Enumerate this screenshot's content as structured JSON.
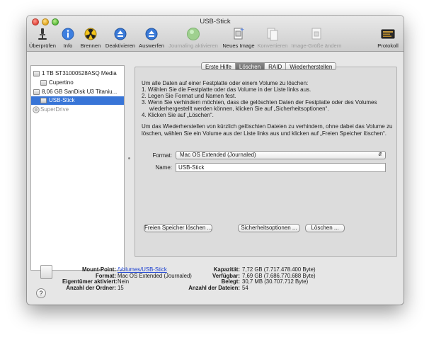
{
  "window": {
    "title": "USB-Stick"
  },
  "toolbar": {
    "items": [
      {
        "label": "Überprüfen",
        "icon": "microscope-icon",
        "enabled": true
      },
      {
        "label": "Info",
        "icon": "info-icon",
        "enabled": true
      },
      {
        "label": "Brennen",
        "icon": "burn-icon",
        "enabled": true
      },
      {
        "label": "Deaktivieren",
        "icon": "unmount-icon",
        "enabled": true
      },
      {
        "label": "Auswerfen",
        "icon": "eject-icon",
        "enabled": true
      },
      {
        "label": "Journaling aktivieren",
        "icon": "journaling-icon",
        "enabled": false
      },
      {
        "label": "Neues Image",
        "icon": "new-image-icon",
        "enabled": true
      },
      {
        "label": "Konvertieren",
        "icon": "convert-icon",
        "enabled": false
      },
      {
        "label": "Image-Größe ändern",
        "icon": "resize-image-icon",
        "enabled": false
      },
      {
        "label": "Protokoll",
        "icon": "log-icon",
        "enabled": true
      }
    ]
  },
  "sidebar": {
    "items": [
      {
        "label": "1 TB ST31000528ASQ Media",
        "indent": 0,
        "selected": false,
        "dimmed": false
      },
      {
        "label": "Cupertino",
        "indent": 1,
        "selected": false,
        "dimmed": false
      },
      {
        "label": "8,06 GB SanDisk U3 Titaniu...",
        "indent": 0,
        "selected": false,
        "dimmed": false
      },
      {
        "label": "USB-Stick",
        "indent": 1,
        "selected": true,
        "dimmed": false
      },
      {
        "label": "SuperDrive",
        "indent": 0,
        "selected": false,
        "dimmed": true
      }
    ]
  },
  "tabs": [
    {
      "label": "Erste Hilfe",
      "active": false
    },
    {
      "label": "Löschen",
      "active": true
    },
    {
      "label": "RAID",
      "active": false
    },
    {
      "label": "Wiederherstellen",
      "active": false
    }
  ],
  "erase": {
    "intro": "Um alle Daten auf einer Festplatte oder einem Volume zu löschen:",
    "steps": [
      "1. Wählen Sie die Festplatte oder das Volume in der Liste links aus.",
      "2. Legen Sie Format und Namen fest.",
      "3. Wenn Sie verhindern möchten, dass die gelöschten Daten der Festplatte oder des Volumes",
      "wiederhergestellt werden können, klicken Sie auf „Sicherheitsoptionen“.",
      "4. Klicken Sie auf „Löschen“."
    ],
    "note_line1": "Um das Wiederherstellen von kürzlich gelöschten Dateien zu verhindern, ohne dabei das Volume zu",
    "note_line2": "löschen, wählen Sie ein Volume aus der Liste links aus und klicken auf „Freien Speicher löschen“.",
    "format_label": "Format:",
    "format_value": "Mac OS Extended (Journaled)",
    "name_label": "Name:",
    "name_value": "USB-Stick",
    "free_space_button": "Freien Speicher löschen ...",
    "security_button": "Sicherheitsoptionen ...",
    "erase_button": "Löschen ..."
  },
  "info": {
    "mount_point_label": "Mount-Point:",
    "mount_point_value": "/Volumes/USB-Stick",
    "format_label": "Format:",
    "format_value": "Mac OS Extended (Journaled)",
    "owners_label": "Eigentümer aktiviert:",
    "owners_value": "Nein",
    "folders_label": "Anzahl der Ordner:",
    "folders_value": "15",
    "capacity_label": "Kapazität:",
    "capacity_value": "7,72 GB (7.717.478.400 Byte)",
    "available_label": "Verfügbar:",
    "available_value": "7,69 GB (7.686.770.688 Byte)",
    "used_label": "Belegt:",
    "used_value": "30,7 MB (30.707.712 Byte)",
    "files_label": "Anzahl der Dateien:",
    "files_value": "54"
  },
  "help": {
    "symbol": "?"
  }
}
